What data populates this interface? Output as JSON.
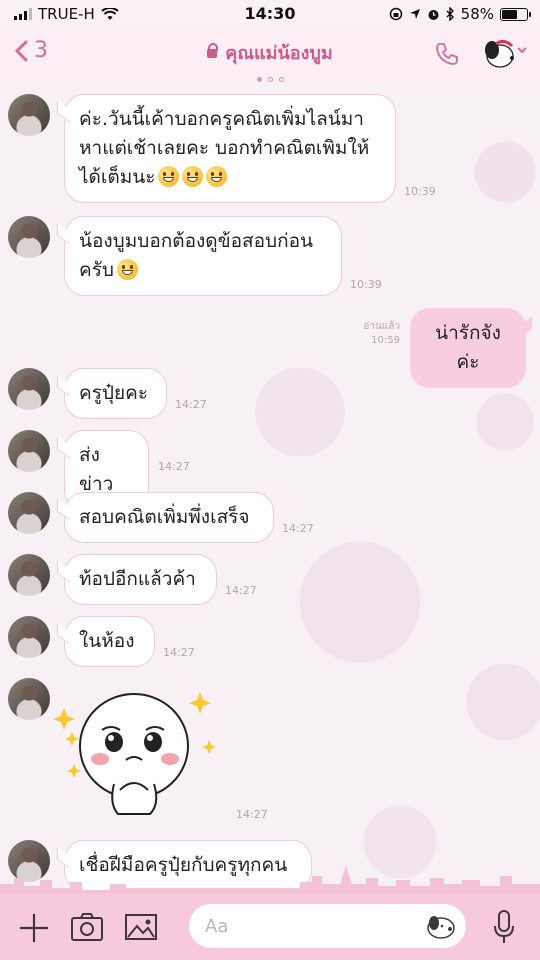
{
  "status": {
    "carrier": "TRUE-H",
    "time": "14:30",
    "battery": "58%",
    "battery_level": 0.58
  },
  "header": {
    "back_count": "3",
    "title": "คุณแม่น้องบูม"
  },
  "messages": [
    {
      "text": "ค่ะ.วันนี้เค้าบอกครูคณิตเพิ่มไลน์มาหาแต่เช้าเลยคะ บอกทำคณิตเพิมให้ได้เต็มนะ",
      "time": "10:39"
    },
    {
      "text": "น้องบูมบอกต้องดูข้อสอบก่อนครับ",
      "time": "10:39"
    },
    {
      "text": "น่ารักจังค่ะ",
      "read": "อ่านแล้ว",
      "time": "10:59"
    },
    {
      "text": "ครูปุ๋ยคะ",
      "time": "14:27"
    },
    {
      "text": "ส่งข่าว",
      "time": "14:27"
    },
    {
      "text": "สอบคณิตเพิ่มพึ่งเสร็จ",
      "time": "14:27"
    },
    {
      "text": "ท้อปอีกแล้วค้า",
      "time": "14:27"
    },
    {
      "text": "ในห้อง",
      "time": "14:27"
    },
    {
      "sticker": "crying-face-sticker",
      "time": "14:27"
    },
    {
      "text": "เชื่อฝีมือครูปุ๋ยกับครูทุกคน"
    }
  ],
  "input": {
    "placeholder": "Aa"
  },
  "icons": [
    "signal-icon",
    "wifi-icon",
    "lock-icon",
    "location-icon",
    "alarm-icon",
    "bluetooth-icon",
    "battery-icon",
    "back-chevron-icon",
    "phone-icon",
    "snoopy-menu-icon",
    "plus-icon",
    "camera-icon",
    "image-icon",
    "sticker-icon",
    "mic-icon"
  ],
  "colors": {
    "accent": "#d86b98",
    "bubble_out": "#f8cde0",
    "input_bar": "#f6cadc"
  }
}
